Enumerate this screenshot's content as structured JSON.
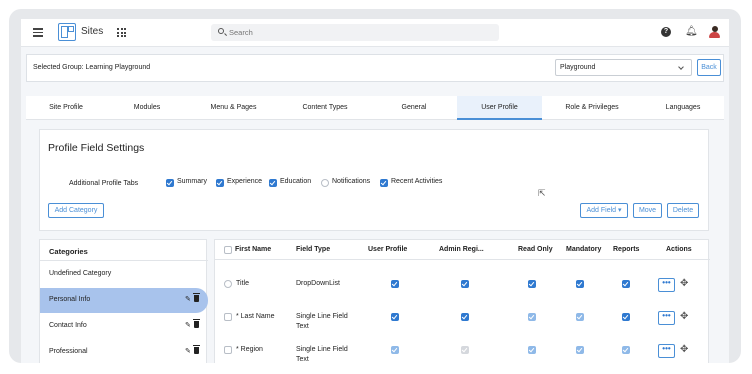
{
  "topbar": {
    "app_name": "Sites",
    "search_placeholder": "Search"
  },
  "group": {
    "label": "Selected Group:  Learning Playground",
    "selected": "Playground",
    "back_label": "Back"
  },
  "tabs": [
    "Site Profile",
    "Modules",
    "Menu & Pages",
    "Content Types",
    "General",
    "User Profile",
    "Role & Privileges",
    "Languages"
  ],
  "active_tab": "User Profile",
  "profile": {
    "title": "Profile Field Settings",
    "additional_label": "Additional Profile Tabs",
    "options": [
      {
        "label": "Summary",
        "checked": true
      },
      {
        "label": "Experience",
        "checked": true
      },
      {
        "label": "Education",
        "checked": true
      },
      {
        "label": "Notifications",
        "checked": false
      },
      {
        "label": "Recent Activities",
        "checked": true
      }
    ],
    "add_category": "Add Category",
    "add_field": "Add Field",
    "move": "Move",
    "delete": "Delete"
  },
  "categories": {
    "header": "Categories",
    "items": [
      "Undefined Category",
      "Personal Info",
      "Contact Info",
      "Professional"
    ],
    "selected": "Personal Info"
  },
  "table": {
    "headers": [
      "First Name",
      "Field Type",
      "User Profile",
      "Admin Regi...",
      "Read Only",
      "Mandatory",
      "Reports",
      "Actions"
    ],
    "rows": [
      {
        "name": "Title",
        "type_1": "DropDownList",
        "type_2": "",
        "user_profile": "on",
        "admin_reg": "on",
        "read_only": "on",
        "mandatory": "on",
        "reports": "on"
      },
      {
        "name": "* Last Name",
        "type_1": "Single Line Field",
        "type_2": "Text",
        "user_profile": "on",
        "admin_reg": "on",
        "read_only": "dim",
        "mandatory": "dim",
        "reports": "on"
      },
      {
        "name": "* Region",
        "type_1": "Single Line Field",
        "type_2": "Text",
        "user_profile": "dim",
        "admin_reg": "grey",
        "read_only": "dim",
        "mandatory": "dim",
        "reports": "dim"
      }
    ],
    "action_label": "•••"
  },
  "colors": {
    "accent": "#2f79d0",
    "selected_category": "#a8c3ec",
    "active_tab_bg": "#e9f1fb"
  }
}
